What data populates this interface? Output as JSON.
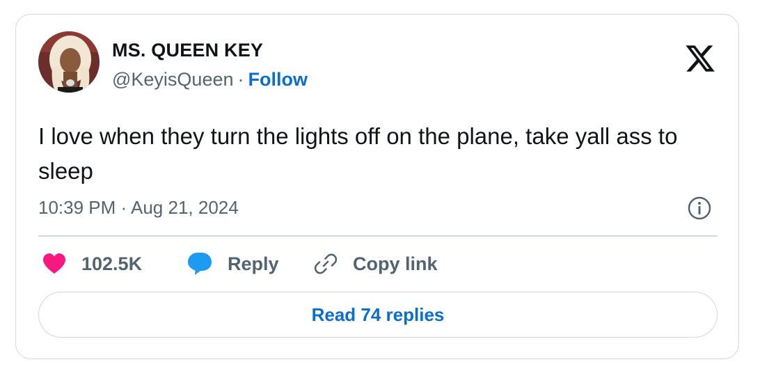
{
  "author": {
    "display_name": "MS. QUEEN KEY",
    "handle": "@KeyisQueen",
    "separator": "·",
    "follow_label": "Follow"
  },
  "tweet": {
    "text": "I love when they turn the lights off on the plane, take yall ass to sleep",
    "time": "10:39 PM",
    "date_separator": "·",
    "date": "Aug 21, 2024"
  },
  "actions": {
    "like_count": "102.5K",
    "reply_label": "Reply",
    "copy_link_label": "Copy link"
  },
  "footer": {
    "read_replies_label": "Read 74 replies"
  },
  "icons": {
    "brand": "x-logo-icon",
    "info": "info-icon",
    "like": "heart-icon",
    "reply": "speech-bubble-icon",
    "copy": "link-icon"
  },
  "colors": {
    "text_primary": "#0f1419",
    "text_secondary": "#536471",
    "link_blue": "#0a6ed1",
    "heart_pink": "#f91880",
    "reply_blue": "#1d9bf0",
    "border": "#cfd9de"
  }
}
